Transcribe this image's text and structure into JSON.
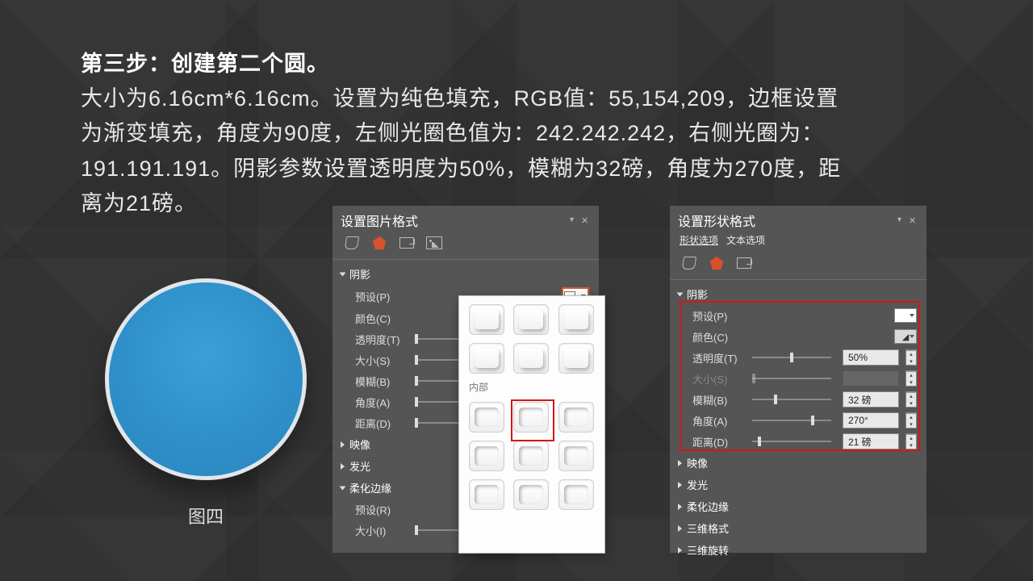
{
  "description": {
    "lead": "第三步：创建第二个圆。",
    "body": "大小为6.16cm*6.16cm。设置为纯色填充，RGB值：55,154,209，边框设置为渐变填充，角度为90度，左侧光圈色值为：242.242.242，右侧光圈为：191.191.191。阴影参数设置透明度为50%，模糊为32磅，角度为270度，距离为21磅。"
  },
  "figure_label": "图四",
  "left_panel": {
    "title": "设置图片格式",
    "shadow": "阴影",
    "preset": "预设(P)",
    "color": "颜色(C)",
    "transparency": "透明度(T)",
    "size": "大小(S)",
    "blur": "模糊(B)",
    "angle": "角度(A)",
    "distance": "距离(D)",
    "reflection": "映像",
    "glow": "发光",
    "soft_edge": "柔化边缘",
    "soft_preset": "预设(R)",
    "soft_size": "大小(I)"
  },
  "preset_popup": {
    "inner_label": "内部"
  },
  "right_panel": {
    "title": "设置形状格式",
    "tab_shape": "形状选项",
    "tab_text": "文本选项",
    "shadow": "阴影",
    "preset": "预设(P)",
    "color": "颜色(C)",
    "transparency": "透明度(T)",
    "size": "大小(S)",
    "blur": "模糊(B)",
    "angle": "角度(A)",
    "distance": "距离(D)",
    "reflection": "映像",
    "glow": "发光",
    "soft_edge": "柔化边缘",
    "three_d_format": "三维格式",
    "three_d_rotate": "三维旋转",
    "val_transparency": "50%",
    "val_size": "",
    "val_blur": "32 磅",
    "val_angle": "270°",
    "val_distance": "21 磅"
  }
}
